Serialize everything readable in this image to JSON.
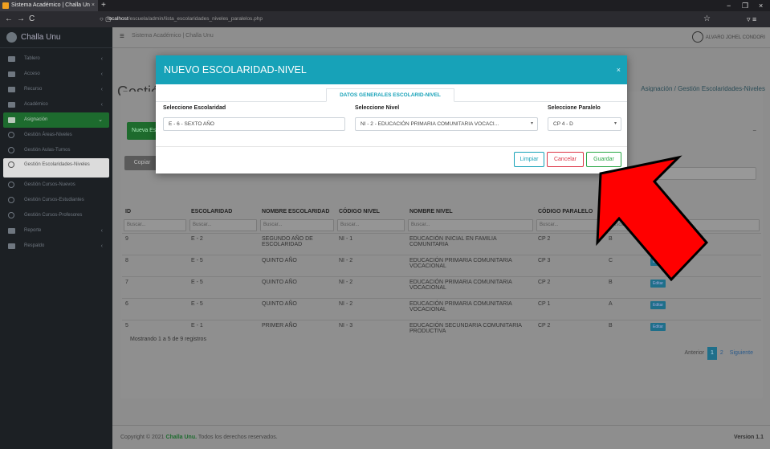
{
  "browser": {
    "tab_title": "Sistema Académico | Challa Un",
    "url_host": "localhost",
    "url_path": "/escuela/admin/lista_escolaridades_niveles_paralelos.php"
  },
  "sidebar": {
    "brand": "Challa Unu",
    "items": [
      {
        "label": "Tablero"
      },
      {
        "label": "Acceso"
      },
      {
        "label": "Recurso"
      },
      {
        "label": "Académico"
      },
      {
        "label": "Asignación"
      },
      {
        "label": "Gestión Áreas-Niveles"
      },
      {
        "label": "Gestión Aulas-Turnos"
      },
      {
        "label": "Gestión Escolaridades-Niveles"
      },
      {
        "label": "Gestión Cursos-Nuevos"
      },
      {
        "label": "Gestión Cursos-Estudiantes"
      },
      {
        "label": "Gestión Cursos-Profesores"
      },
      {
        "label": "Reporte"
      },
      {
        "label": "Respaldo"
      }
    ]
  },
  "topbar": {
    "app_title": "Sistema Académico | Challa Unu",
    "user_name": "ALVARO JOHEL CONDORI"
  },
  "page": {
    "title": "Gestión",
    "breadcrumb_parent": "Asignación",
    "breadcrumb_current": "Gestión Escolaridades-Niveles",
    "new_button": "Nueva Es",
    "copy_button": "Copiar",
    "search_label": "Buscar:",
    "minimize": "−"
  },
  "table": {
    "headers": [
      "ID",
      "ESCOLARIDAD",
      "NOMBRE ESCOLARIDAD",
      "CÓDIGO NIVEL",
      "NOMBRE NIVEL",
      "CÓDIGO PARALELO",
      "PARALELO",
      "OPCIONES"
    ],
    "filter_placeholder": "Buscar...",
    "edit_label": "Editar",
    "rows": [
      [
        "9",
        "E - 2",
        "SEGUNDO AÑO DE ESCOLARIDAD",
        "NI - 1",
        "EDUCACIÓN INICIAL EN FAMILIA COMUNITARIA",
        "CP 2",
        "B"
      ],
      [
        "8",
        "E - 5",
        "QUINTO AÑO",
        "NI - 2",
        "EDUCACIÓN PRIMARIA COMUNITARIA VOCACIONAL",
        "CP 3",
        "C"
      ],
      [
        "7",
        "E - 5",
        "QUINTO AÑO",
        "NI - 2",
        "EDUCACIÓN PRIMARIA COMUNITARIA VOCACIONAL",
        "CP 2",
        "B"
      ],
      [
        "6",
        "E - 5",
        "QUINTO AÑO",
        "NI - 2",
        "EDUCACIÓN PRIMARIA COMUNITARIA VOCACIONAL",
        "CP 1",
        "A"
      ],
      [
        "5",
        "E - 1",
        "PRIMER AÑO",
        "NI - 3",
        "EDUCACIÓN SECUNDARIA COMUNITARIA PRODUCTIVA",
        "CP 2",
        "B"
      ]
    ],
    "showing": "Mostrando 1 a 5 de 9 registros",
    "pager": {
      "prev": "Anterior",
      "p1": "1",
      "p2": "2",
      "next": "Siguiente"
    }
  },
  "footer": {
    "copyright": "Copyright © 2021 ",
    "brand": "Challa Unu.",
    "rights": " Todos los derechos reservados.",
    "version": "Version 1.1"
  },
  "modal": {
    "title": "NUEVO ESCOLARIDAD-NIVEL",
    "close": "×",
    "tab": "DATOS GENERALES ESCOLARID-NIVEL",
    "field1_label": "Seleccione Escolaridad",
    "field1_value": "E - 6 - SEXTO AÑO",
    "field2_label": "Seleccione Nivel",
    "field2_value": "NI - 2 - EDUCACIÓN PRIMARIA COMUNITARIA VOCACI...",
    "field3_label": "Seleccione Paralelo",
    "field3_value": "CP 4 - D",
    "btn_clear": "Limpiar",
    "btn_cancel": "Cancelar",
    "btn_save": "Guardar"
  },
  "colors": {
    "accent": "#17a2b8",
    "arrow": "#ff0000",
    "sidebar_active": "#1d6b2e"
  }
}
